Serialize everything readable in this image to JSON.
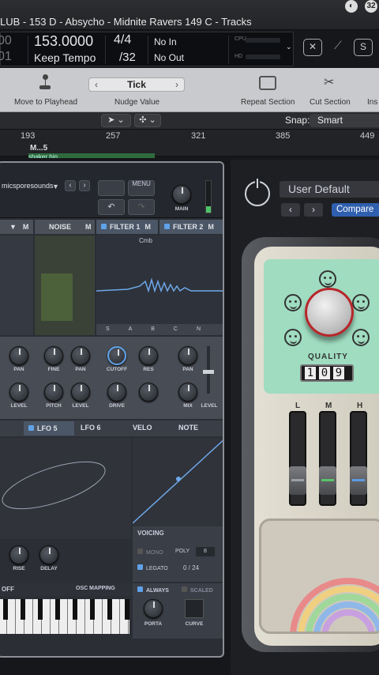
{
  "titlebar": {
    "title": "LUB - 153 D  -  Absycho - Midnite Ravers 149 C - Tracks",
    "icons": [
      "user-circle-icon",
      "badge-32-icon"
    ],
    "badge_text": "32"
  },
  "lcd": {
    "bar_top": "00",
    "bar_bottom": "01",
    "tempo": "153.0000",
    "tempo_mode": "Keep Tempo",
    "time_sig": "4/4",
    "division": "/32",
    "midi_in": "No In",
    "midi_out": "No Out",
    "cpu_label": "CPU",
    "hd_label": "HD"
  },
  "controlbar": {
    "move_to_playhead": "Move to Playhead",
    "nudge_value": "Tick",
    "nudge_label": "Nudge Value",
    "repeat_section": "Repeat Section",
    "cut_section": "Cut Section",
    "insert_cut": "Ins"
  },
  "toolbar": {
    "snap_label": "Snap:",
    "snap_value": "Smart"
  },
  "ruler": {
    "marks": [
      "193",
      "257",
      "321",
      "385",
      "449"
    ],
    "marker": "M...5",
    "region": "shaker hip"
  },
  "synth": {
    "preset_author": "micsporesounds",
    "menu": "MENU",
    "main": "MAIN",
    "noise": "NOISE",
    "filter1": "FILTER 1",
    "filter2": "FILTER 2",
    "filter_type": "Cmb",
    "m": "M",
    "filter_tabs": [
      "S",
      "A",
      "B",
      "C",
      "N"
    ],
    "knob_labels_row1": [
      "PAN",
      "FINE",
      "PAN",
      "CUTOFF",
      "RES",
      "PAN"
    ],
    "knob_labels_row2": [
      "LEVEL",
      "PITCH",
      "LEVEL",
      "DRIVE",
      "MIX",
      "LEVEL"
    ],
    "lfo5": "LFO 5",
    "lfo6": "LFO 6",
    "velo": "VELO",
    "note": "NOTE",
    "voicing": "VOICING",
    "mono": "MONO",
    "poly": "POLY",
    "poly_value": "8",
    "legato": "LEGATO",
    "voices": "0 / 24",
    "rise": "RISE",
    "delay": "DELAY",
    "off": "OFF",
    "osc_mapping": "OSC MAPPING",
    "always": "ALWAYS",
    "scaled": "SCALED",
    "porta": "PORTA",
    "curve": "CURVE"
  },
  "plugin": {
    "preset": "User Default",
    "compare": "Compare",
    "quality": "QUALITY",
    "quality_digits": [
      "1",
      "0",
      "9"
    ],
    "bands": [
      "L",
      "M",
      "H"
    ]
  }
}
